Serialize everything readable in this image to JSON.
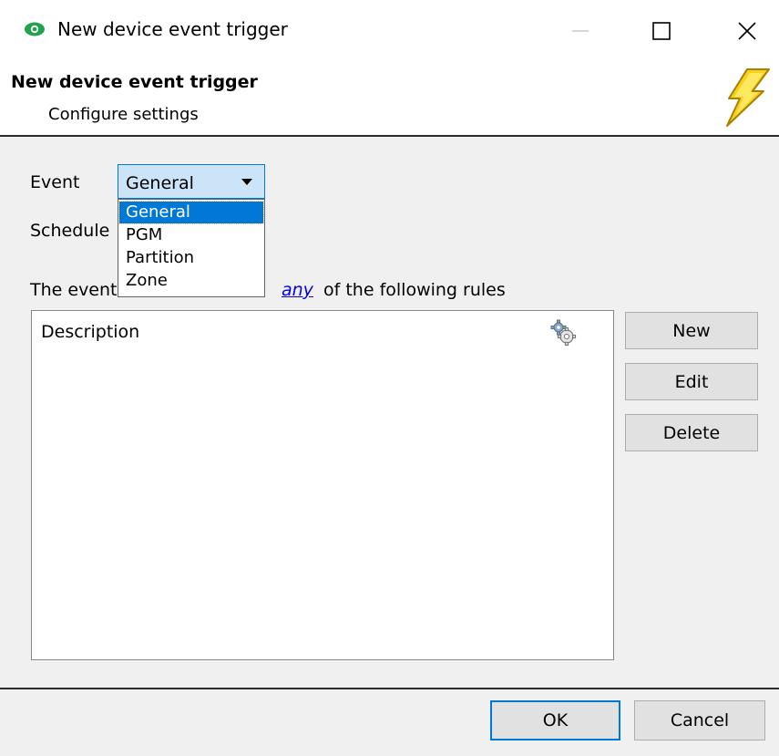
{
  "window": {
    "title": "New device event trigger",
    "icon": "eye-icon",
    "controls": {
      "minimize": "minimize-icon",
      "maximize": "maximize-icon",
      "close": "close-icon"
    }
  },
  "header": {
    "title": "New device event trigger",
    "subtitle": "Configure settings",
    "icon": "lightning-bolt-icon"
  },
  "form": {
    "event_label": "Event",
    "event_value": "General",
    "event_options": [
      "General",
      "PGM",
      "Partition",
      "Zone"
    ],
    "schedule_label": "Schedule",
    "rules_text_before": "The event",
    "rules_link": "any",
    "rules_text_after": "of the following rules"
  },
  "rules_list": {
    "column_header": "Description",
    "header_icon": "gear-icon",
    "rows": []
  },
  "side_buttons": {
    "new": "New",
    "edit": "Edit",
    "delete": "Delete"
  },
  "footer": {
    "ok": "OK",
    "cancel": "Cancel"
  },
  "colors": {
    "accent": "#0078d7",
    "selection": "#0078d7",
    "dropdown_bg": "#cce4f7",
    "panel_bg": "#f0f0f0",
    "link": "#0000ee"
  }
}
